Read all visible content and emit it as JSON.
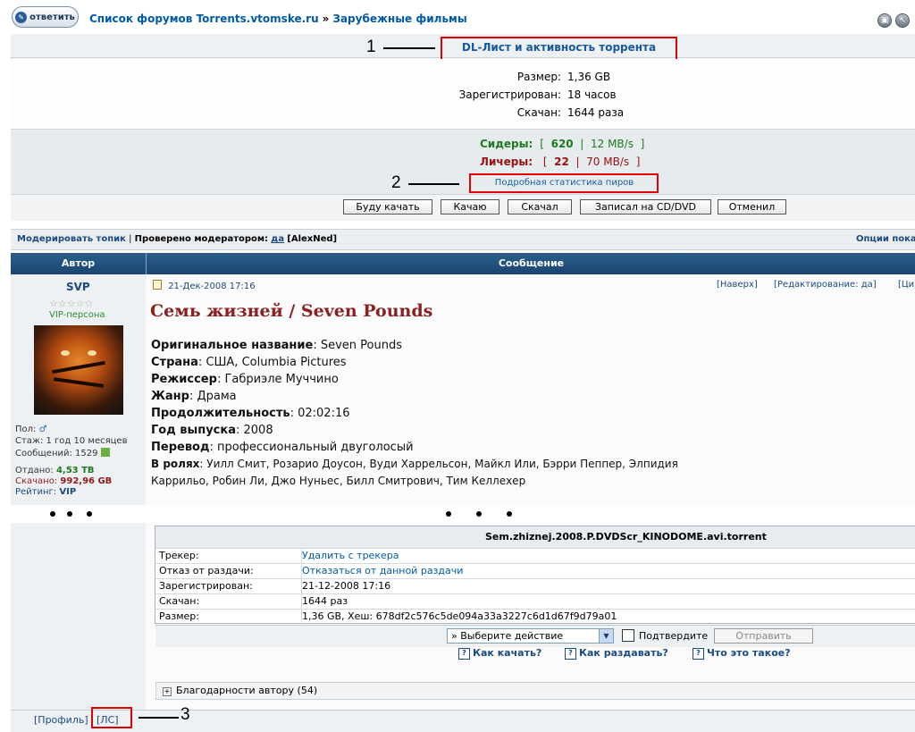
{
  "topbar": {
    "reply_label": "ответить",
    "crumb1": "Список форумов Torrents.vtomske.ru",
    "crumb_sep": "»",
    "crumb2": "Зарубежные фильмы"
  },
  "dl": {
    "title": "DL-Лист и активность торрента",
    "size_label": "Размер:",
    "size_value": "1,36 GB",
    "registered_label": "Зарегистрирован:",
    "registered_value": "18 часов",
    "downloaded_label": "Скачан:",
    "downloaded_value": "1644 раза",
    "seeders_label": "Сидеры:",
    "seeders_count": "620",
    "seeders_speed": "12 MB/s",
    "leechers_label": "Личеры:",
    "leechers_count": "22",
    "leechers_speed": "70 MB/s",
    "peer_stats_link": "Подробная статистика пиров",
    "actions": [
      "Буду качать",
      "Качаю",
      "Скачал",
      "Записал на CD/DVD",
      "Отменил"
    ]
  },
  "annotations": {
    "a1": "1",
    "a2": "2",
    "a3": "3"
  },
  "modbar": {
    "moderate": "Модерировать топик",
    "checked": "Проверено модератором:",
    "yes": "да",
    "moderator": "[AlexNed]",
    "options": "Опции пока"
  },
  "table_header": {
    "author": "Автор",
    "message": "Сообщение"
  },
  "author": {
    "name": "SVP",
    "rank": "VIP-персона",
    "gender": "Пол:",
    "experience": "Стаж: 1 год 10 месяцев",
    "posts": "Сообщений: 1529",
    "uploaded_label": "Отдано:",
    "uploaded_value": "4,53 TB",
    "downloaded_label": "Скачано:",
    "downloaded_value": "992,96 GB",
    "rating_label": "Рейтинг:",
    "rating_value": "VIP"
  },
  "post": {
    "date": "21-Дек-2008 17:16",
    "top_link": "[Наверх]",
    "edit_link": "[Редактирование: да]",
    "quote_link": "[Ци",
    "title": "Семь жизней / Seven Pounds",
    "lines": [
      {
        "k": "Оригинальное название",
        "v": "Seven Pounds"
      },
      {
        "k": "Страна",
        "v": "США, Columbia Pictures"
      },
      {
        "k": "Режиссер",
        "v": "Габриэле Муччино"
      },
      {
        "k": "Жанр",
        "v": "Драма"
      },
      {
        "k": "Продолжительность",
        "v": "02:02:16"
      },
      {
        "k": "Год выпуска",
        "v": "2008"
      },
      {
        "k": "Перевод",
        "v": "профессиональный двуголосый"
      },
      {
        "k": "В ролях",
        "v": "Уилл Смит, Розарио Доусон, Вуди Харрельсон, Майкл Или, Бэрри Пеппер, Элпидия"
      }
    ],
    "cast_cont": "Каррильо, Робин Ли, Джо Нуньес, Билл Смитрович, Тим Келлехер"
  },
  "torrent": {
    "filename": "Sem.zhiznej.2008.P.DVDScr_KINODOME.avi.torrent",
    "rows": [
      {
        "k": "Трекер:",
        "v": "Удалить с трекера"
      },
      {
        "k": "Отказ от раздачи:",
        "v": "Отказаться от данной раздачи"
      },
      {
        "k": "Зарегистрирован:",
        "v": "21-12-2008 17:16"
      },
      {
        "k": "Скачан:",
        "v": "1644 раз"
      },
      {
        "k": "Размер:",
        "v": "1,36 GB, Хеш: 678df2c576c5de094a33a3227c6d1d67f9d79a01"
      }
    ],
    "select_value": "» Выберите действие",
    "confirm_label": "Подтвердите",
    "send_label": "Отправить",
    "help1": "Как качать?",
    "help2": "Как раздавать?",
    "help3": "Что это такое?",
    "thanks": "Благодарности автору (54)"
  },
  "footer": {
    "profile": "[Профиль]",
    "pm": "[ЛС]"
  }
}
